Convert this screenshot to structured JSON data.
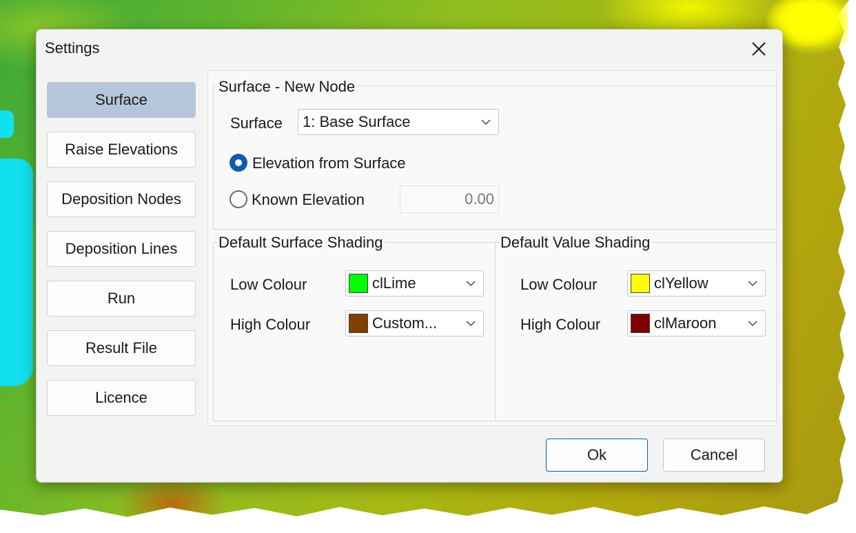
{
  "window": {
    "title": "Settings"
  },
  "nav": {
    "items": [
      {
        "label": "Surface",
        "active": true
      },
      {
        "label": "Raise Elevations"
      },
      {
        "label": "Deposition Nodes"
      },
      {
        "label": "Deposition Lines"
      },
      {
        "label": "Run"
      },
      {
        "label": "Result File"
      },
      {
        "label": "Licence"
      }
    ]
  },
  "new_node": {
    "group_title": "Surface - New Node",
    "surface_label": "Surface",
    "surface_value": "1: Base Surface",
    "radio_elevation_from_surface": "Elevation from Surface",
    "radio_known_elevation": "Known Elevation",
    "selected": "Elevation from Surface",
    "known_elevation_value": "0.00"
  },
  "surface_shading": {
    "group_title": "Default Surface Shading",
    "low_label": "Low Colour",
    "low_value": "clLime",
    "low_color": "#00ff00",
    "high_label": "High Colour",
    "high_value": "Custom...",
    "high_color": "#804000"
  },
  "value_shading": {
    "group_title": "Default Value Shading",
    "low_label": "Low Colour",
    "low_value": "clYellow",
    "low_color": "#ffff00",
    "high_label": "High Colour",
    "high_value": "clMaroon",
    "high_color": "#800000"
  },
  "buttons": {
    "ok": "Ok",
    "cancel": "Cancel"
  },
  "accent_color": "#0b5cad"
}
